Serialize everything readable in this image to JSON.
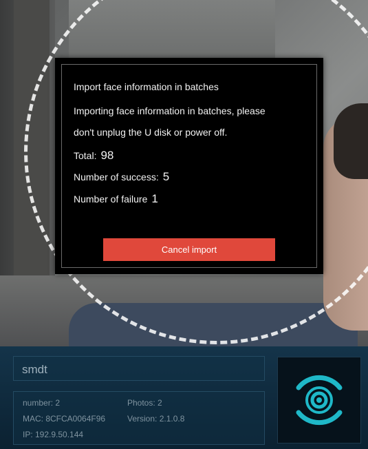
{
  "dialog": {
    "title": "Import face information in batches",
    "message_line1": "Importing face information in batches, please",
    "message_line2": "don't unplug the U disk or power off.",
    "total_label": "Total:",
    "total_value": "98",
    "success_label": "Number of success:",
    "success_value": "5",
    "failure_label": "Number of failure",
    "failure_value": "1",
    "cancel_label": "Cancel import"
  },
  "device": {
    "name": "smdt",
    "number": "number: 2",
    "photos": "Photos: 2",
    "mac": "MAC: 8CFCA0064F96",
    "version": "Version: 2.1.0.8",
    "ip": "IP: 192.9.50.144"
  },
  "colors": {
    "accent": "#e0483b",
    "panel": "#0b2131",
    "logo": "#1fb8c8"
  },
  "icons": {
    "device_logo": "concentric-rings-icon"
  }
}
